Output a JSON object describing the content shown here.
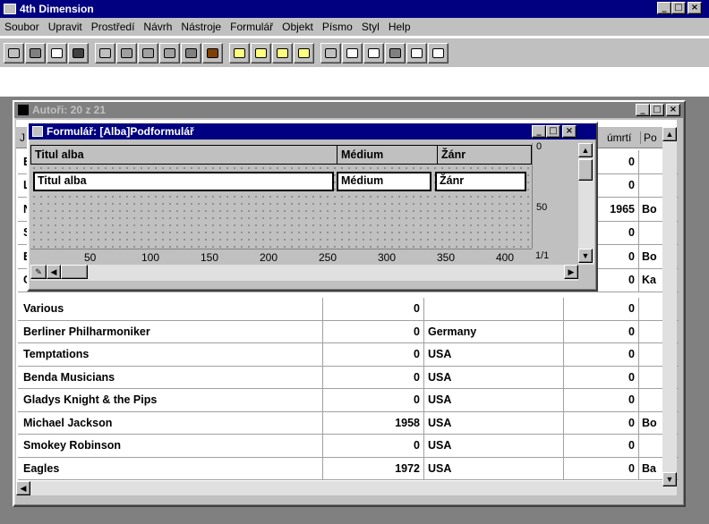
{
  "app": {
    "title": "4th Dimension"
  },
  "menu": [
    "Soubor",
    "Upravit",
    "Prostředí",
    "Návrh",
    "Nástroje",
    "Formulář",
    "Objekt",
    "Písmo",
    "Styl",
    "Help"
  ],
  "toolbar_icons": [
    "open-icon",
    "save-icon",
    "preview-icon",
    "print-icon",
    "undo-icon",
    "cut-icon",
    "copy-icon",
    "paste-icon",
    "clear-icon",
    "tools-icon",
    "form-icon",
    "edit-form-icon",
    "new-form-icon",
    "form-props-icon",
    "explorer-icon",
    "list-icon",
    "design-icon",
    "structure-icon",
    "user-icon",
    "check-icon"
  ],
  "back_window": {
    "title": "Autoři: 20 z 21",
    "header_partial": [
      "J",
      "úmrtí",
      "Po"
    ]
  },
  "subform_window": {
    "title": "Formulář: [Alba]Podformulář",
    "headers": [
      "Titul alba",
      "Médium",
      "Žánr"
    ],
    "fields": [
      "Titul alba",
      "Médium",
      "Žánr"
    ],
    "ruler": [
      "50",
      "100",
      "150",
      "200",
      "250",
      "300",
      "350",
      "400"
    ],
    "vruler": [
      "0",
      "50"
    ],
    "page": "1/1"
  },
  "partial_rows": [
    {
      "left": "E",
      "death": "0",
      "po": ""
    },
    {
      "left": "L",
      "death": "0",
      "po": ""
    },
    {
      "left": "N",
      "death": "1965",
      "po": "Bo"
    },
    {
      "left": "S",
      "death": "0",
      "po": ""
    },
    {
      "left": "E",
      "death": "0",
      "po": "Bo"
    },
    {
      "left": "C",
      "death": "0",
      "po": "Ka"
    }
  ],
  "rows": [
    {
      "name": "Various",
      "year": "0",
      "country": "",
      "death": "0",
      "po": ""
    },
    {
      "name": "Berliner Philharmoniker",
      "year": "0",
      "country": "Germany",
      "death": "0",
      "po": ""
    },
    {
      "name": "Temptations",
      "year": "0",
      "country": "USA",
      "death": "0",
      "po": ""
    },
    {
      "name": "Benda Musicians",
      "year": "0",
      "country": "USA",
      "death": "0",
      "po": ""
    },
    {
      "name": "Gladys Knight & the Pips",
      "year": "0",
      "country": "USA",
      "death": "0",
      "po": ""
    },
    {
      "name": "Michael Jackson",
      "year": "1958",
      "country": "USA",
      "death": "0",
      "po": "Bo"
    },
    {
      "name": "Smokey Robinson",
      "year": "0",
      "country": "USA",
      "death": "0",
      "po": ""
    },
    {
      "name": "Eagles",
      "year": "1972",
      "country": "USA",
      "death": "0",
      "po": "Ba"
    }
  ]
}
